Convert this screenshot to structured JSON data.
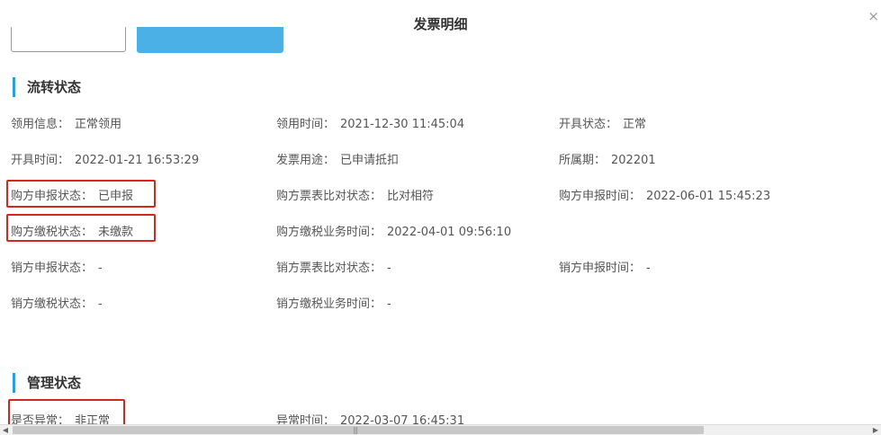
{
  "dialog": {
    "title": "发票明细",
    "close_icon": "×"
  },
  "colors": {
    "accent": "#2a9fe0",
    "primary_button": "#4bb0e6",
    "highlight": "#d9261c"
  },
  "sections": {
    "circulation": {
      "title": "流转状态",
      "fields": {
        "lingyong_info": {
          "label": "领用信息：",
          "value": "正常领用"
        },
        "lingyong_time": {
          "label": "领用时间：",
          "value": "2021-12-30 11:45:04"
        },
        "kaiju_status": {
          "label": "开具状态：",
          "value": "正常"
        },
        "kaiju_time": {
          "label": "开具时间：",
          "value": "2022-01-21 16:53:29"
        },
        "invoice_use": {
          "label": "发票用途：",
          "value": "已申请抵扣"
        },
        "period": {
          "label": "所属期：",
          "value": "202201"
        },
        "buyer_declare": {
          "label": "购方申报状态：",
          "value": "已申报"
        },
        "buyer_compare": {
          "label": "购方票表比对状态：",
          "value": "比对相符"
        },
        "buyer_declare_time": {
          "label": "购方申报时间：",
          "value": "2022-06-01 15:45:23"
        },
        "buyer_tax": {
          "label": "购方缴税状态：",
          "value": "未缴款"
        },
        "buyer_tax_time": {
          "label": "购方缴税业务时间：",
          "value": "2022-04-01 09:56:10"
        },
        "seller_declare": {
          "label": "销方申报状态：",
          "value": "-"
        },
        "seller_compare": {
          "label": "销方票表比对状态：",
          "value": "-"
        },
        "seller_declare_time": {
          "label": "销方申报时间：",
          "value": "-"
        },
        "seller_tax": {
          "label": "销方缴税状态：",
          "value": "-"
        },
        "seller_tax_time": {
          "label": "销方缴税业务时间：",
          "value": "-"
        }
      }
    },
    "management": {
      "title": "管理状态",
      "fields": {
        "abnormal": {
          "label": "是否异常：",
          "value": "非正常"
        },
        "abnormal_time": {
          "label": "异常时间：",
          "value": "2022-03-07 16:45:31"
        }
      }
    }
  }
}
